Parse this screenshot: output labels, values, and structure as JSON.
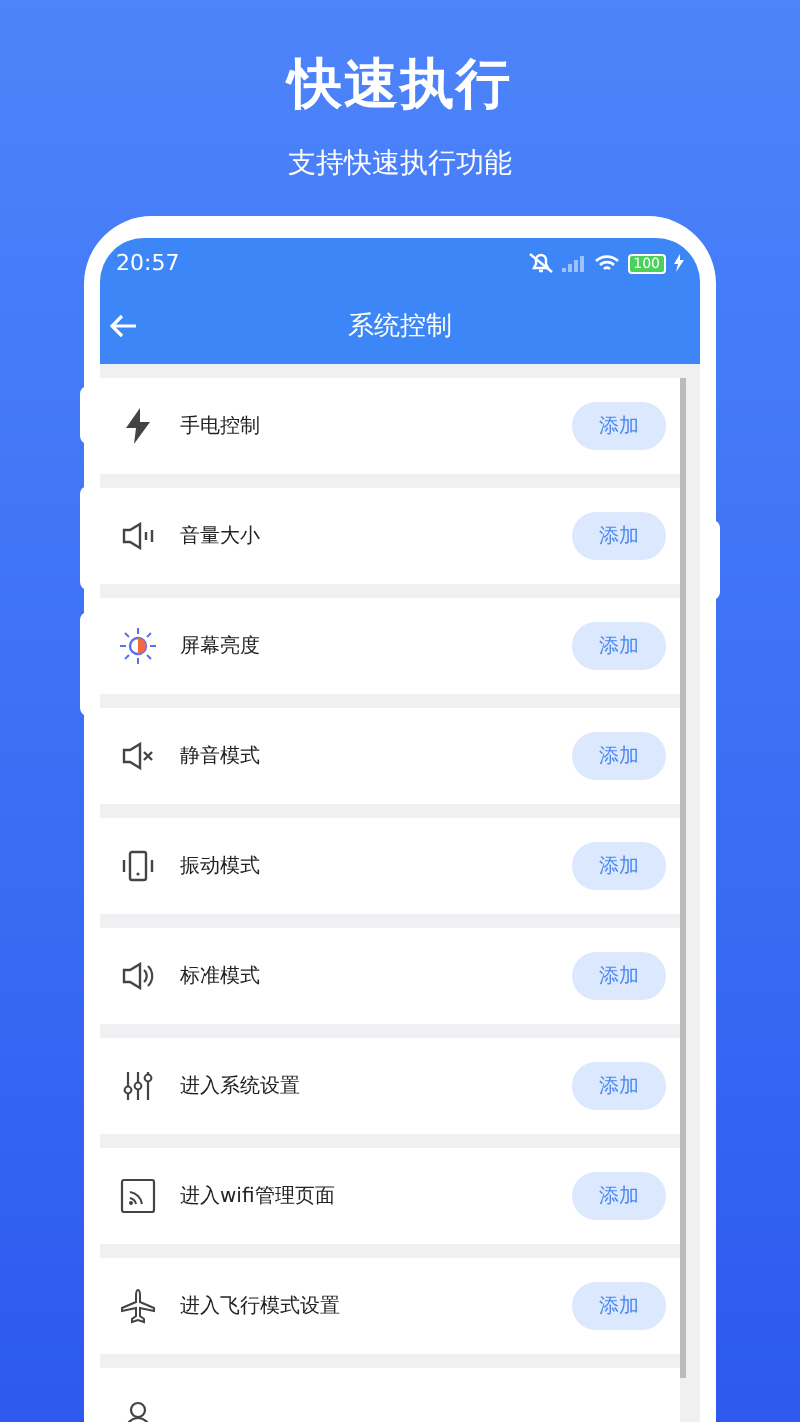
{
  "title": "快速执行",
  "subtitle": "支持快速执行功能",
  "status_bar": {
    "time": "20:57",
    "battery": "100"
  },
  "header": {
    "title": "系统控制"
  },
  "items": [
    {
      "kind": "flash",
      "label": "手电控制",
      "button": "添加"
    },
    {
      "kind": "volume",
      "label": "音量大小",
      "button": "添加"
    },
    {
      "kind": "brightness",
      "label": "屏幕亮度",
      "button": "添加"
    },
    {
      "kind": "mute",
      "label": "静音模式",
      "button": "添加"
    },
    {
      "kind": "vibrate",
      "label": "振动模式",
      "button": "添加"
    },
    {
      "kind": "sound",
      "label": "标准模式",
      "button": "添加"
    },
    {
      "kind": "sliders",
      "label": "进入系统设置",
      "button": "添加"
    },
    {
      "kind": "wifi",
      "label": "进入wifi管理页面",
      "button": "添加"
    },
    {
      "kind": "airplane",
      "label": "进入飞行模式设置",
      "button": "添加"
    },
    {
      "kind": "developer"
    }
  ]
}
